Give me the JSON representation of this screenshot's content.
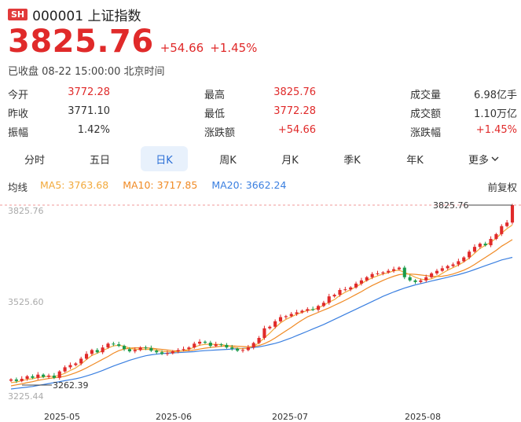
{
  "header": {
    "exchange_badge": "SH",
    "code_name": "000001 上证指数"
  },
  "quote": {
    "price": "3825.76",
    "change": "+54.66",
    "change_pct": "+1.45%",
    "status": "已收盘 08-22 15:00:00 北京时间"
  },
  "stats": [
    [
      {
        "label": "今开",
        "value": "3772.28",
        "red": true
      },
      {
        "label": "最高",
        "value": "3825.76",
        "red": true
      },
      {
        "label": "成交量",
        "value": "6.98亿手",
        "red": false
      }
    ],
    [
      {
        "label": "昨收",
        "value": "3771.10",
        "red": false
      },
      {
        "label": "最低",
        "value": "3772.28",
        "red": true
      },
      {
        "label": "成交额",
        "value": "1.10万亿",
        "red": false
      }
    ],
    [
      {
        "label": "振幅",
        "value": "1.42%",
        "red": false
      },
      {
        "label": "涨跌额",
        "value": "+54.66",
        "red": true
      },
      {
        "label": "涨跌幅",
        "value": "+1.45%",
        "red": true
      }
    ]
  ],
  "tabs": [
    "分时",
    "五日",
    "日K",
    "周K",
    "月K",
    "季K",
    "年K",
    "更多"
  ],
  "active_tab": "日K",
  "ma": {
    "title": "均线",
    "ma5": "MA5: 3763.68",
    "ma10": "MA10: 3717.85",
    "ma20": "MA20: 3662.24",
    "adjust": "前复权"
  },
  "colors": {
    "up": "#e02a2a",
    "down": "#1a9b4a",
    "ma5": "#f2a93b",
    "ma10": "#f08a24",
    "ma20": "#3a7fe0",
    "active_tab": "#2b6fd6"
  },
  "chart_data": {
    "type": "candlestick",
    "y_labels": [
      "3825.76",
      "3525.60",
      "3225.44"
    ],
    "ylim": [
      3225.44,
      3825.76
    ],
    "x_labels": [
      "2025-05",
      "2025-06",
      "2025-07",
      "2025-08"
    ],
    "max_marker": "3825.76",
    "min_marker": "3262.39",
    "close": [
      3280,
      3275,
      3282,
      3290,
      3285,
      3295,
      3288,
      3292,
      3285,
      3305,
      3318,
      3325,
      3330,
      3345,
      3360,
      3372,
      3365,
      3380,
      3392,
      3390,
      3385,
      3375,
      3368,
      3372,
      3380,
      3378,
      3370,
      3365,
      3360,
      3362,
      3368,
      3372,
      3375,
      3380,
      3392,
      3398,
      3395,
      3385,
      3390,
      3388,
      3380,
      3376,
      3370,
      3372,
      3380,
      3394,
      3410,
      3440,
      3445,
      3462,
      3475,
      3478,
      3485,
      3490,
      3495,
      3500,
      3498,
      3510,
      3520,
      3540,
      3545,
      3560,
      3562,
      3568,
      3580,
      3590,
      3600,
      3610,
      3612,
      3615,
      3620,
      3625,
      3630,
      3600,
      3590,
      3585,
      3590,
      3600,
      3612,
      3620,
      3628,
      3635,
      3640,
      3650,
      3662,
      3680,
      3695,
      3705,
      3700,
      3720,
      3735,
      3760,
      3771.1,
      3825.76
    ],
    "ma5": [
      3270,
      3272,
      3276,
      3280,
      3282,
      3286,
      3288,
      3290,
      3289,
      3293,
      3299,
      3308,
      3316,
      3328,
      3342,
      3355,
      3362,
      3370,
      3378,
      3385,
      3387,
      3384,
      3378,
      3374,
      3374,
      3374,
      3374,
      3372,
      3368,
      3367,
      3366,
      3367,
      3370,
      3374,
      3381,
      3387,
      3390,
      3390,
      3390,
      3389,
      3386,
      3382,
      3378,
      3376,
      3378,
      3384,
      3395,
      3410,
      3425,
      3442,
      3457,
      3468,
      3476,
      3484,
      3490,
      3496,
      3498,
      3504,
      3512,
      3522,
      3530,
      3543,
      3553,
      3561,
      3570,
      3580,
      3590,
      3598,
      3604,
      3610,
      3614,
      3620,
      3622,
      3615,
      3608,
      3600,
      3594,
      3592,
      3595,
      3602,
      3612,
      3622,
      3630,
      3638,
      3648,
      3660,
      3675,
      3690,
      3700,
      3710,
      3722,
      3738,
      3752,
      3763.68
    ],
    "ma10": [
      3260,
      3263,
      3266,
      3270,
      3273,
      3277,
      3280,
      3283,
      3285,
      3287,
      3290,
      3295,
      3301,
      3308,
      3316,
      3325,
      3334,
      3343,
      3352,
      3362,
      3370,
      3375,
      3378,
      3379,
      3379,
      3379,
      3378,
      3376,
      3374,
      3372,
      3370,
      3369,
      3369,
      3370,
      3372,
      3375,
      3378,
      3380,
      3382,
      3384,
      3385,
      3385,
      3384,
      3383,
      3382,
      3383,
      3386,
      3392,
      3400,
      3410,
      3421,
      3432,
      3443,
      3455,
      3466,
      3476,
      3483,
      3490,
      3497,
      3504,
      3512,
      3520,
      3528,
      3537,
      3546,
      3555,
      3565,
      3574,
      3582,
      3590,
      3597,
      3603,
      3608,
      3610,
      3610,
      3609,
      3607,
      3605,
      3603,
      3602,
      3603,
      3606,
      3610,
      3616,
      3622,
      3630,
      3640,
      3651,
      3662,
      3673,
      3684,
      3697,
      3707,
      3717.85
    ],
    "ma20": [
      3250,
      3252,
      3254,
      3256,
      3258,
      3261,
      3264,
      3267,
      3270,
      3273,
      3276,
      3279,
      3282,
      3286,
      3291,
      3296,
      3302,
      3308,
      3315,
      3322,
      3328,
      3334,
      3340,
      3345,
      3350,
      3354,
      3357,
      3359,
      3361,
      3362,
      3363,
      3364,
      3365,
      3366,
      3367,
      3369,
      3370,
      3371,
      3372,
      3373,
      3374,
      3375,
      3376,
      3377,
      3378,
      3380,
      3382,
      3385,
      3389,
      3393,
      3398,
      3404,
      3410,
      3417,
      3424,
      3431,
      3438,
      3445,
      3452,
      3460,
      3468,
      3476,
      3484,
      3492,
      3500,
      3508,
      3516,
      3524,
      3532,
      3540,
      3547,
      3554,
      3560,
      3566,
      3571,
      3576,
      3580,
      3584,
      3588,
      3592,
      3596,
      3600,
      3604,
      3608,
      3613,
      3618,
      3624,
      3630,
      3636,
      3642,
      3648,
      3654,
      3658,
      3662.24
    ]
  }
}
